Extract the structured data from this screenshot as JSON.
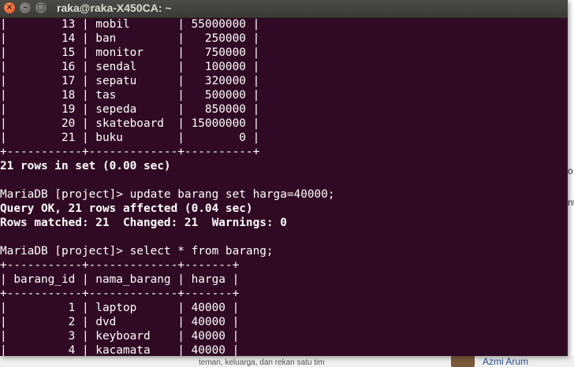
{
  "terminal": {
    "title": "raka@raka-X450CA: ~",
    "buttons": {
      "close": "×",
      "minimize": "–",
      "maximize": "□"
    },
    "lines": [
      {
        "text": "|        13 | mobil       | 55000000 |",
        "bold": false
      },
      {
        "text": "|        14 | ban         |   250000 |",
        "bold": false
      },
      {
        "text": "|        15 | monitor     |   750000 |",
        "bold": false
      },
      {
        "text": "|        16 | sendal      |   100000 |",
        "bold": false
      },
      {
        "text": "|        17 | sepatu      |   320000 |",
        "bold": false
      },
      {
        "text": "|        18 | tas         |   500000 |",
        "bold": false
      },
      {
        "text": "|        19 | sepeda      |   850000 |",
        "bold": false
      },
      {
        "text": "|        20 | skateboard  | 15000000 |",
        "bold": false
      },
      {
        "text": "|        21 | buku        |        0 |",
        "bold": false
      },
      {
        "text": "+-----------+-------------+----------+",
        "bold": false
      },
      {
        "text": "21 rows in set (0.00 sec)",
        "bold": true
      },
      {
        "text": "",
        "bold": false
      },
      {
        "text": "MariaDB [project]> update barang set harga=40000;",
        "bold": false
      },
      {
        "text": "Query OK, 21 rows affected (0.04 sec)",
        "bold": true
      },
      {
        "text": "Rows matched: 21  Changed: 21  Warnings: 0",
        "bold": true
      },
      {
        "text": "",
        "bold": false
      },
      {
        "text": "MariaDB [project]> select * from barang;",
        "bold": false
      },
      {
        "text": "+-----------+-------------+-------+",
        "bold": false
      },
      {
        "text": "| barang_id | nama_barang | harga |",
        "bold": false
      },
      {
        "text": "+-----------+-------------+-------+",
        "bold": false
      },
      {
        "text": "|         1 | laptop      | 40000 |",
        "bold": false
      },
      {
        "text": "|         2 | dvd         | 40000 |",
        "bold": false
      },
      {
        "text": "|         3 | keyboard    | 40000 |",
        "bold": false
      },
      {
        "text": "|         4 | kacamata    | 40000 |",
        "bold": false
      }
    ]
  },
  "background": {
    "right_fragments": [
      "o",
      "nt"
    ],
    "post_text": "teman, keluarga, dan rekan satu tim",
    "user_name": "Azmi Arum"
  }
}
